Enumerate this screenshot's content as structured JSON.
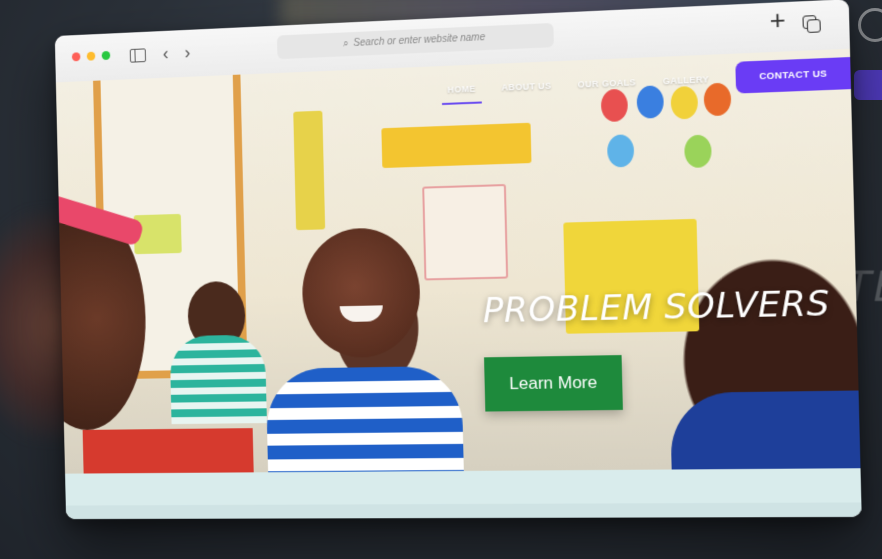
{
  "browser": {
    "address_placeholder": "Search or enter website name",
    "toolbar_icons": [
      "sidebar-icon",
      "back-icon",
      "forward-icon",
      "new-tab-icon",
      "tabs-overview-icon"
    ]
  },
  "site": {
    "nav": {
      "items": [
        {
          "label": "HOME",
          "active": true
        },
        {
          "label": "ABOUT US",
          "active": false
        },
        {
          "label": "OUR GOALS",
          "active": false
        },
        {
          "label": "GALLERY",
          "active": false
        }
      ],
      "contact_label": "CONTACT US"
    },
    "hero": {
      "title": "PROBLEM SOLVERS",
      "cta_label": "Learn More"
    }
  },
  "background": {
    "ghost_text": "TE"
  },
  "colors": {
    "accent_purple": "#6a3cf5",
    "cta_green": "#1e8a3c",
    "footer_tint": "#d9ecec"
  }
}
